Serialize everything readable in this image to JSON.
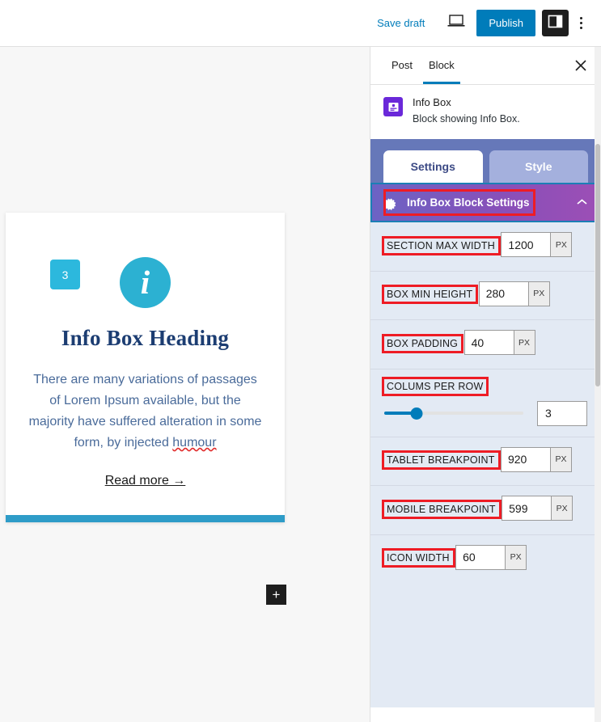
{
  "toolbar": {
    "save_draft_label": "Save draft",
    "preview_icon": "laptop-preview-icon",
    "publish_label": "Publish",
    "sidebar_toggle_icon": "sidebar-panel-icon",
    "more_menu_icon": "vertical-dots-icon"
  },
  "canvas": {
    "card": {
      "badge": "3",
      "icon_glyph": "i",
      "icon_name": "info-circle-icon",
      "heading": "Info Box Heading",
      "text_part1": "There are many variations of passages of Lorem Ipsum available, but the majority have suffered alteration in some form, by injected ",
      "text_misspelled": "humour",
      "link_label": "Read more →"
    },
    "appender_label": "+"
  },
  "sidebar": {
    "tabs": [
      {
        "label": "Post",
        "active": false
      },
      {
        "label": "Block",
        "active": true
      }
    ],
    "close_icon": "close-icon",
    "block": {
      "icon_name": "info-box-block-icon",
      "title": "Info Box",
      "description": "Block showing Info Box."
    },
    "plugin_tabs": [
      {
        "label": "Settings",
        "active": true
      },
      {
        "label": "Style",
        "active": false
      }
    ],
    "accordion": {
      "icon_name": "gear-icon",
      "title": "Info Box Block Settings",
      "chevron": "⌃",
      "expanded": true
    },
    "fields": [
      {
        "label": "SECTION MAX WIDTH",
        "value": "1200",
        "unit": "PX",
        "type": "unit"
      },
      {
        "label": "BOX MIN HEIGHT",
        "value": "280",
        "unit": "PX",
        "type": "unit"
      },
      {
        "label": "BOX PADDING",
        "value": "40",
        "unit": "PX",
        "type": "unit"
      },
      {
        "label": "COLUMS PER ROW",
        "value": "3",
        "type": "range",
        "range_percent": 23
      },
      {
        "label": "TABLET BREAKPOINT",
        "value": "920",
        "unit": "PX",
        "type": "unit"
      },
      {
        "label": "MOBILE BREAKPOINT",
        "value": "599",
        "unit": "PX",
        "type": "unit"
      },
      {
        "label": "ICON WIDTH",
        "value": "60",
        "unit": "PX",
        "type": "unit"
      }
    ]
  },
  "colors": {
    "publish_blue": "#007cba",
    "accent_cyan": "#2cb8dd",
    "heading_navy": "#1c3d72",
    "annotation_red": "#ee1c25",
    "panel_purple": "#8a4fb8",
    "tabstrip_blue": "#6678b9"
  }
}
